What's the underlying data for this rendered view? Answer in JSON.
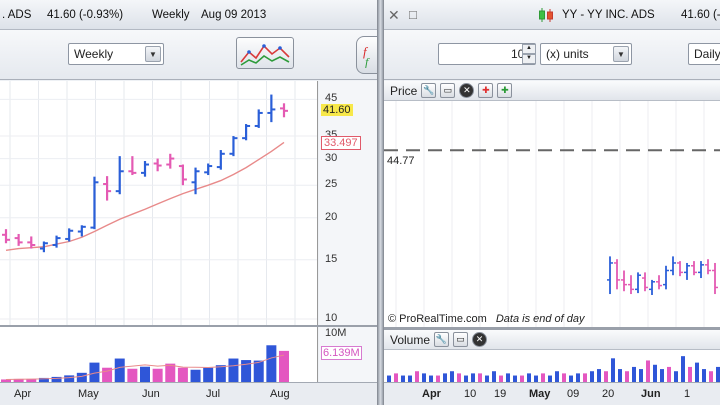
{
  "left": {
    "title": {
      "symbol": ". ADS",
      "price": "41.60 (-0.93%)",
      "period": "Weekly",
      "date": "Aug 09 2013"
    },
    "toolbar": {
      "timeframe": "Weekly",
      "indicator_icon": "indicator-chart-icon",
      "side_icon": "function-icon"
    },
    "price_axis": {
      "ticks": [
        "45",
        "35",
        "30",
        "25",
        "20",
        "15",
        "10"
      ],
      "current_price": "41.60",
      "ma_value": "33.497",
      "current_price_color": "#f7e84a",
      "ma_value_color": "#e05a6a"
    },
    "volume_axis": {
      "top": "10M",
      "current": "6.139M"
    },
    "x_labels": [
      "Apr",
      "May",
      "Jun",
      "Jul",
      "Aug"
    ]
  },
  "right": {
    "title": {
      "symbol": "YY - YY INC. ADS",
      "price": "41.60 (-"
    },
    "window_controls": {
      "close": "✕",
      "minimize": "□"
    },
    "toolbar": {
      "units_value": "100",
      "units_label": "(x) units",
      "timeframe": "Daily"
    },
    "price_panel": {
      "label": "Price",
      "level": "44.77",
      "watermark": "© ProRealTime.com",
      "watermark_note": "Data is end of day"
    },
    "volume_panel": {
      "label": "Volume"
    },
    "x_labels": [
      {
        "text": "Apr",
        "bold": true
      },
      {
        "text": "10",
        "bold": false
      },
      {
        "text": "19",
        "bold": false
      },
      {
        "text": "May",
        "bold": true
      },
      {
        "text": "09",
        "bold": false
      },
      {
        "text": "20",
        "bold": false
      },
      {
        "text": "Jun",
        "bold": true
      },
      {
        "text": "1",
        "bold": false
      }
    ]
  },
  "chart_data": {
    "type": "ohlc",
    "timeframe": "Weekly",
    "y_scale": "log",
    "ylim": [
      10,
      47
    ],
    "categories": [
      "",
      "",
      "",
      "",
      "",
      "",
      "",
      "",
      "",
      "",
      "",
      "",
      "",
      "",
      "",
      "",
      "",
      "",
      "",
      "",
      "",
      "",
      ""
    ],
    "bars": [
      {
        "o": 17.8,
        "h": 18.5,
        "l": 16.8,
        "c": 17.2,
        "dir": "down"
      },
      {
        "o": 17.4,
        "h": 17.9,
        "l": 16.5,
        "c": 16.9,
        "dir": "down"
      },
      {
        "o": 16.9,
        "h": 17.6,
        "l": 16.2,
        "c": 16.6,
        "dir": "down"
      },
      {
        "o": 16.2,
        "h": 17.0,
        "l": 15.8,
        "c": 16.8,
        "dir": "up"
      },
      {
        "o": 16.6,
        "h": 17.7,
        "l": 16.3,
        "c": 17.4,
        "dir": "up"
      },
      {
        "o": 17.3,
        "h": 18.6,
        "l": 17.0,
        "c": 18.3,
        "dir": "up"
      },
      {
        "o": 18.2,
        "h": 19.0,
        "l": 17.6,
        "c": 18.8,
        "dir": "up"
      },
      {
        "o": 18.7,
        "h": 26.5,
        "l": 18.5,
        "c": 25.5,
        "dir": "up"
      },
      {
        "o": 25.2,
        "h": 26.6,
        "l": 22.5,
        "c": 24.0,
        "dir": "down"
      },
      {
        "o": 24.0,
        "h": 30.5,
        "l": 23.5,
        "c": 27.5,
        "dir": "up"
      },
      {
        "o": 27.5,
        "h": 30.5,
        "l": 26.8,
        "c": 27.2,
        "dir": "down"
      },
      {
        "o": 27.2,
        "h": 29.5,
        "l": 26.5,
        "c": 28.8,
        "dir": "up"
      },
      {
        "o": 29.0,
        "h": 30.0,
        "l": 27.5,
        "c": 28.6,
        "dir": "down"
      },
      {
        "o": 28.8,
        "h": 31.0,
        "l": 28.0,
        "c": 30.0,
        "dir": "down"
      },
      {
        "o": 28.5,
        "h": 28.8,
        "l": 25.0,
        "c": 26.0,
        "dir": "down"
      },
      {
        "o": 25.5,
        "h": 28.2,
        "l": 23.5,
        "c": 27.5,
        "dir": "up"
      },
      {
        "o": 27.3,
        "h": 29.0,
        "l": 26.8,
        "c": 28.5,
        "dir": "up"
      },
      {
        "o": 28.3,
        "h": 31.8,
        "l": 27.8,
        "c": 31.0,
        "dir": "up"
      },
      {
        "o": 31.0,
        "h": 35.0,
        "l": 30.5,
        "c": 34.5,
        "dir": "up"
      },
      {
        "o": 34.5,
        "h": 38.0,
        "l": 34.0,
        "c": 37.5,
        "dir": "up"
      },
      {
        "o": 37.5,
        "h": 42.0,
        "l": 37.0,
        "c": 41.0,
        "dir": "up"
      },
      {
        "o": 41.0,
        "h": 46.5,
        "l": 38.5,
        "c": 42.0,
        "dir": "up"
      },
      {
        "o": 42.3,
        "h": 43.8,
        "l": 39.8,
        "c": 41.6,
        "dir": "down"
      }
    ],
    "moving_average": [
      16.0,
      16.2,
      16.3,
      16.4,
      16.7,
      17.0,
      17.5,
      18.2,
      19.0,
      19.8,
      20.5,
      21.2,
      22.0,
      22.8,
      23.6,
      24.3,
      25.0,
      25.8,
      26.9,
      28.2,
      29.8,
      31.5,
      33.5
    ],
    "volume": {
      "ylim": [
        0,
        10
      ],
      "unit": "M",
      "values": [
        0.5,
        0.6,
        0.6,
        0.8,
        1.0,
        1.3,
        1.8,
        3.8,
        2.8,
        4.6,
        2.6,
        3.0,
        2.6,
        3.6,
        2.8,
        2.4,
        2.8,
        3.3,
        4.6,
        4.3,
        4.2,
        7.2,
        6.1
      ],
      "dirs": [
        "down",
        "down",
        "down",
        "up",
        "up",
        "up",
        "up",
        "up",
        "down",
        "up",
        "down",
        "up",
        "down",
        "down",
        "down",
        "up",
        "up",
        "up",
        "up",
        "up",
        "up",
        "up",
        "down"
      ]
    },
    "right_chart": {
      "type": "ohlc",
      "timeframe": "Daily",
      "level_line": 44.77,
      "bars": [
        {
          "o": 31.0,
          "h": 33.5,
          "l": 29.5,
          "c": 32.8,
          "dir": "up"
        },
        {
          "o": 32.8,
          "h": 33.2,
          "l": 30.0,
          "c": 31.0,
          "dir": "down"
        },
        {
          "o": 31.0,
          "h": 32.0,
          "l": 29.8,
          "c": 30.5,
          "dir": "down"
        },
        {
          "o": 30.5,
          "h": 31.5,
          "l": 29.5,
          "c": 30.0,
          "dir": "down"
        },
        {
          "o": 30.0,
          "h": 31.8,
          "l": 29.6,
          "c": 31.5,
          "dir": "up"
        },
        {
          "o": 31.2,
          "h": 31.8,
          "l": 29.8,
          "c": 30.2,
          "dir": "down"
        },
        {
          "o": 30.0,
          "h": 31.0,
          "l": 29.4,
          "c": 30.8,
          "dir": "up"
        },
        {
          "o": 30.8,
          "h": 31.5,
          "l": 30.0,
          "c": 30.4,
          "dir": "down"
        },
        {
          "o": 30.5,
          "h": 32.5,
          "l": 30.0,
          "c": 32.0,
          "dir": "up"
        },
        {
          "o": 32.0,
          "h": 33.5,
          "l": 31.5,
          "c": 32.8,
          "dir": "up"
        },
        {
          "o": 32.8,
          "h": 33.0,
          "l": 31.4,
          "c": 31.8,
          "dir": "down"
        },
        {
          "o": 31.8,
          "h": 32.8,
          "l": 31.0,
          "c": 32.5,
          "dir": "up"
        },
        {
          "o": 32.5,
          "h": 33.0,
          "l": 31.5,
          "c": 31.8,
          "dir": "down"
        },
        {
          "o": 31.8,
          "h": 33.0,
          "l": 31.2,
          "c": 32.6,
          "dir": "up"
        },
        {
          "o": 32.6,
          "h": 33.2,
          "l": 31.6,
          "c": 32.0,
          "dir": "down"
        },
        {
          "o": 32.0,
          "h": 32.8,
          "l": 29.5,
          "c": 30.2,
          "dir": "down"
        }
      ],
      "volume": [
        0.3,
        0.4,
        0.3,
        0.3,
        0.5,
        0.4,
        0.3,
        0.3,
        0.4,
        0.5,
        0.4,
        0.3,
        0.4,
        0.4,
        0.3,
        0.5,
        0.3,
        0.4,
        0.3,
        0.3,
        0.4,
        0.3,
        0.4,
        0.3,
        0.5,
        0.4,
        0.3,
        0.4,
        0.4,
        0.5,
        0.6,
        0.5,
        1.1,
        0.6,
        0.5,
        0.7,
        0.6,
        1.0,
        0.8,
        0.6,
        0.7,
        0.5,
        1.2,
        0.7,
        0.9,
        0.6,
        0.5,
        0.7
      ]
    }
  },
  "colors": {
    "up_bar": "#2a5fd8",
    "down_bar": "#e45ab3",
    "ma_line": "#e88a8a",
    "vol_up": "#2f56d8",
    "vol_down": "#e457c0"
  }
}
